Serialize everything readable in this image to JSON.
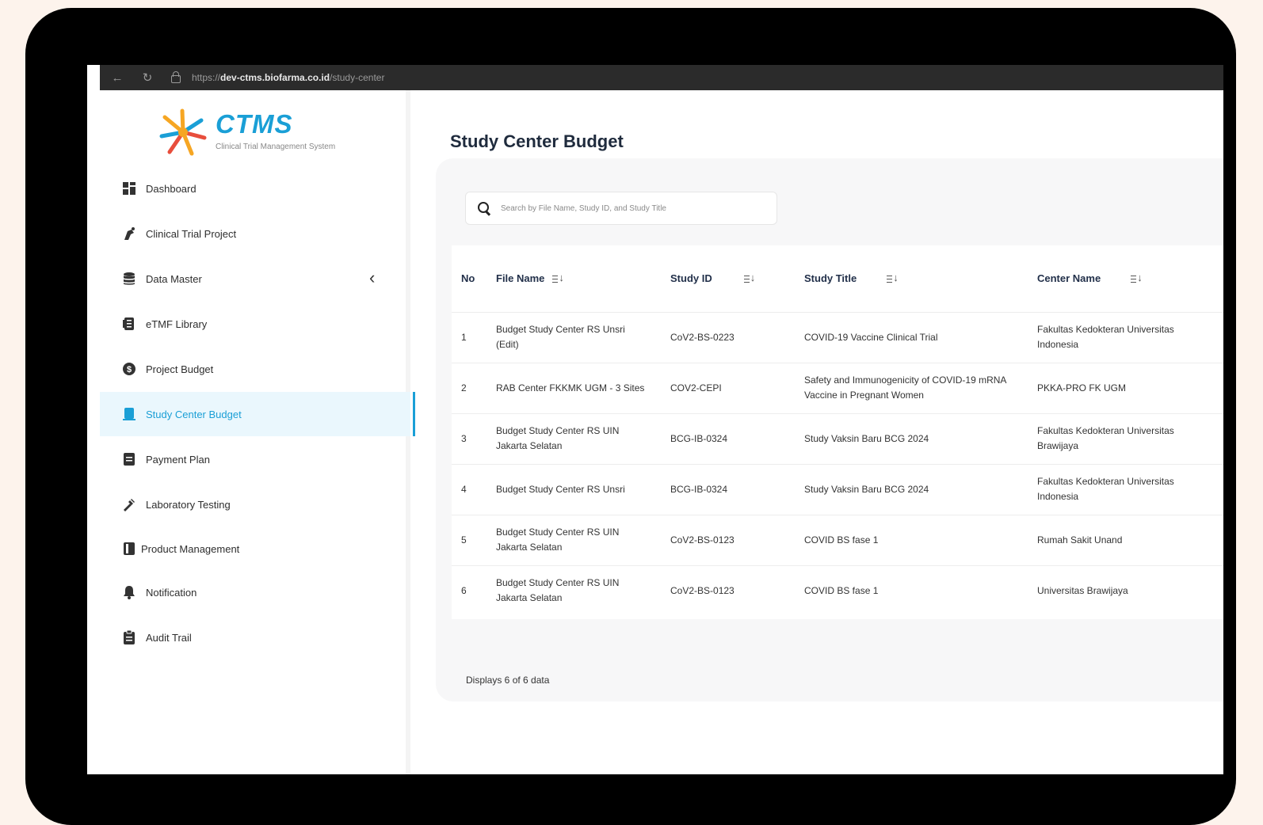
{
  "browser": {
    "url_scheme": "https://",
    "url_host": "dev-ctms.biofarma.co.id",
    "url_path": "/study-center"
  },
  "logo": {
    "brand": "CTMS",
    "tagline": "Clinical Trial Management System"
  },
  "sidebar": {
    "items": [
      {
        "label": "Dashboard",
        "icon": "dashboard-icon"
      },
      {
        "label": "Clinical Trial Project",
        "icon": "clinical-trial-icon"
      },
      {
        "label": "Data Master",
        "icon": "database-icon"
      },
      {
        "label": "eTMF Library",
        "icon": "library-icon"
      },
      {
        "label": "Project Budget",
        "icon": "budget-icon"
      },
      {
        "label": "Study Center Budget",
        "icon": "study-center-icon",
        "active": true
      },
      {
        "label": "Payment Plan",
        "icon": "payment-icon"
      },
      {
        "label": "Laboratory Testing",
        "icon": "lab-icon"
      },
      {
        "label": "Product Management",
        "icon": "product-icon"
      },
      {
        "label": "Notification",
        "icon": "bell-icon"
      },
      {
        "label": "Audit Trail",
        "icon": "clipboard-icon"
      }
    ],
    "collapse_glyph": "‹"
  },
  "main": {
    "title": "Study Center Budget",
    "search_placeholder": "Search by File Name, Study ID, and Study Title",
    "table": {
      "headers": [
        "No",
        "File Name",
        "Study ID",
        "Study Title",
        "Center Name"
      ],
      "rows": [
        [
          "1",
          "Budget Study Center RS Unsri (Edit)",
          "CoV2-BS-0223",
          "COVID-19 Vaccine Clinical Trial",
          "Fakultas Kedokteran Universitas Indonesia"
        ],
        [
          "2",
          "RAB Center FKKMK UGM - 3 Sites",
          "COV2-CEPI",
          "Safety and Immunogenicity of COVID-19 mRNA Vaccine in Pregnant Women",
          "PKKA-PRO FK UGM"
        ],
        [
          "3",
          "Budget Study Center RS UIN Jakarta Selatan",
          "BCG-IB-0324",
          "Study Vaksin Baru BCG 2024",
          "Fakultas Kedokteran Universitas Brawijaya"
        ],
        [
          "4",
          "Budget Study Center RS Unsri",
          "BCG-IB-0324",
          "Study Vaksin Baru BCG 2024",
          "Fakultas Kedokteran Universitas Indonesia"
        ],
        [
          "5",
          "Budget Study Center RS UIN Jakarta Selatan",
          "CoV2-BS-0123",
          "COVID BS fase 1",
          "Rumah Sakit Unand"
        ],
        [
          "6",
          "Budget Study Center RS UIN Jakarta Selatan",
          "CoV2-BS-0123",
          "COVID BS fase 1",
          "Universitas Brawijaya"
        ]
      ]
    },
    "footer_count": "Displays 6 of 6 data"
  },
  "colors": {
    "accent": "#1a9fd6",
    "active_bg": "#eaf7fd",
    "title": "#1f2b3d"
  }
}
